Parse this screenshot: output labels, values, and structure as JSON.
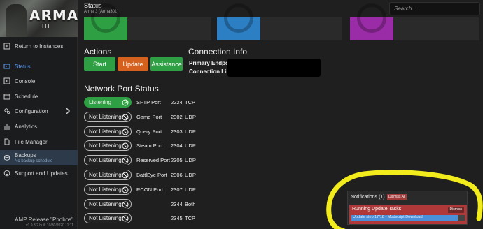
{
  "header": {
    "title": "Status",
    "subtitle": "Arma 3 (Arma301)",
    "search_placeholder": "Search..."
  },
  "logo": {
    "text": "ARMA",
    "sub": "III"
  },
  "sidebar": {
    "items": [
      {
        "label": "Return to Instances",
        "icon": "return-icon"
      },
      {
        "label": "Status",
        "icon": "status-icon"
      },
      {
        "label": "Console",
        "icon": "console-icon"
      },
      {
        "label": "Schedule",
        "icon": "calendar-icon"
      },
      {
        "label": "Configuration",
        "icon": "gears-icon"
      },
      {
        "label": "Analytics",
        "icon": "chart-icon"
      },
      {
        "label": "File Manager",
        "icon": "file-icon"
      },
      {
        "label": "Backups",
        "sub": "No backup schedule",
        "icon": "backup-icon"
      },
      {
        "label": "Support and Updates",
        "icon": "support-icon"
      }
    ],
    "footer": {
      "release": "AMP Release \"Phobos\"",
      "version": "v1.9.3.2 built 10/30/2020 11:11"
    }
  },
  "cards": [
    {
      "color": "#2ea043"
    },
    {
      "color": "#2d7fc4"
    },
    {
      "color": "#9b2ca8"
    }
  ],
  "actions": {
    "title": "Actions",
    "start": "Start",
    "update": "Update",
    "assistance": "Assistance"
  },
  "connection": {
    "title": "Connection Info",
    "endpoint_label": "Primary Endpoint",
    "link_label": "Connection Link"
  },
  "ports": {
    "title": "Network Port Status",
    "rows": [
      {
        "status": "Listening",
        "name": "SFTP Port",
        "port": "2224",
        "proto": "TCP",
        "listening": true
      },
      {
        "status": "Not Listening",
        "name": "Game Port",
        "port": "2302",
        "proto": "UDP",
        "listening": false
      },
      {
        "status": "Not Listening",
        "name": "Query Port",
        "port": "2303",
        "proto": "UDP",
        "listening": false
      },
      {
        "status": "Not Listening",
        "name": "Steam Port",
        "port": "2304",
        "proto": "UDP",
        "listening": false
      },
      {
        "status": "Not Listening",
        "name": "Reserved Port",
        "port": "2305",
        "proto": "UDP",
        "listening": false
      },
      {
        "status": "Not Listening",
        "name": "BattlEye Port",
        "port": "2306",
        "proto": "UDP",
        "listening": false
      },
      {
        "status": "Not Listening",
        "name": "RCON Port",
        "port": "2307",
        "proto": "UDP",
        "listening": false
      },
      {
        "status": "Not Listening",
        "name": "",
        "port": "2344",
        "proto": "Both",
        "listening": false
      },
      {
        "status": "Not Listening",
        "name": "",
        "port": "2345",
        "proto": "TCP",
        "listening": false
      }
    ]
  },
  "notifications": {
    "title": "Notifications (1)",
    "dismiss_all": "Dismiss All",
    "task_title": "Running Update Tasks",
    "dismiss": "Dismiss",
    "progress_text": "Update step 17/18 - Modscript Download",
    "progress_fraction": 0.94,
    "annotation_color": "#f2ec1c"
  }
}
